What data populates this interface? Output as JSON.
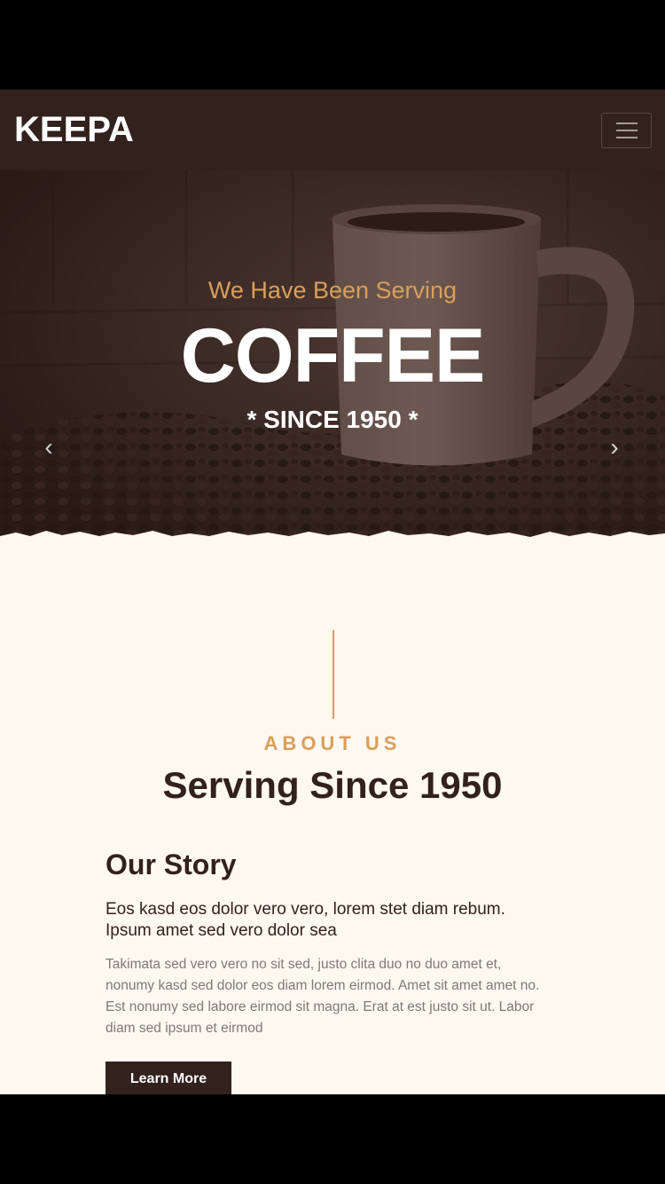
{
  "navbar": {
    "brand": "KEEPA",
    "menu_icon": "hamburger-menu-icon"
  },
  "hero": {
    "subtitle": "We Have Been Serving",
    "title": "COFFEE",
    "since": "* SINCE 1950 *",
    "prev_icon": "chevron-left-icon",
    "next_icon": "chevron-right-icon",
    "prev_glyph": "‹",
    "next_glyph": "›"
  },
  "about": {
    "label": "ABOUT US",
    "title": "Serving Since 1950",
    "story_title": "Our Story",
    "story_lead": "Eos kasd eos dolor vero vero, lorem stet diam rebum. Ipsum amet sed vero dolor sea",
    "story_body": "Takimata sed vero vero no sit sed, justo clita duo no duo amet et, nonumy kasd sed dolor eos diam lorem eirmod. Amet sit amet amet no. Est nonumy sed labore eirmod sit magna. Erat at est justo sit ut. Labor diam sed ipsum et eirmod",
    "button_label": "Learn More"
  },
  "colors": {
    "dark_brown": "#33211d",
    "accent_gold": "#da9f5b",
    "cream_bg": "#fdf8f0"
  }
}
